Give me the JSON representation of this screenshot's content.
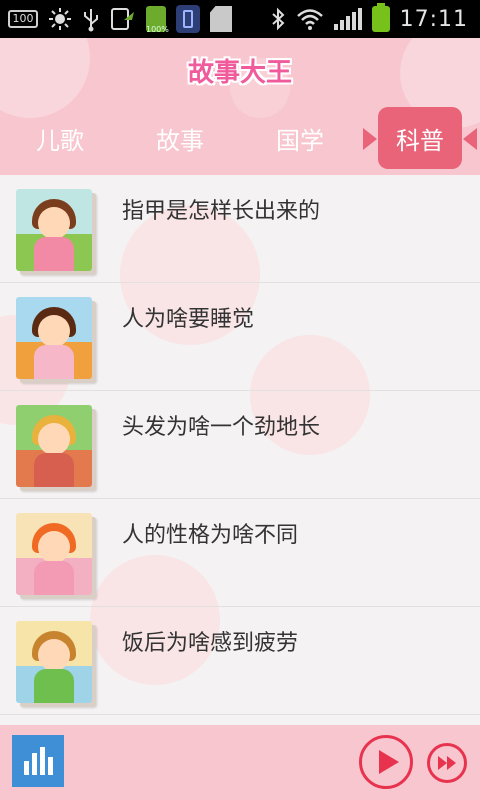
{
  "statusbar": {
    "battery_small_label": "100",
    "battery_green_label": "100%",
    "time": "17:11",
    "icons": [
      "battery-100-icon",
      "sun-icon",
      "usb-icon",
      "sync-icon",
      "battery-full-icon",
      "phone-icon",
      "sd-card-icon",
      "bluetooth-icon",
      "wifi-icon",
      "signal-icon",
      "battery-icon"
    ]
  },
  "header": {
    "title": "故事大王",
    "tabs": [
      {
        "label": "儿歌"
      },
      {
        "label": "故事"
      },
      {
        "label": "国学"
      },
      {
        "label": "科普",
        "active": true
      }
    ]
  },
  "list": {
    "items": [
      {
        "title": "指甲是怎样长出来的",
        "thumb": "girl-hands-thumbnail"
      },
      {
        "title": "人为啥要睡觉",
        "thumb": "girl-sleeping-thumbnail"
      },
      {
        "title": "头发为啥一个劲地长",
        "thumb": "girl-long-hair-thumbnail"
      },
      {
        "title": "人的性格为啥不同",
        "thumb": "boy-cooking-thumbnail"
      },
      {
        "title": "饭后为啥感到疲劳",
        "thumb": "baby-sleepy-thumbnail"
      }
    ]
  },
  "bottombar": {
    "icons": [
      "equalizer-icon",
      "play-icon",
      "fast-forward-icon"
    ]
  },
  "colors": {
    "accent": "#e96479",
    "header_bg": "#f7c6ce",
    "title_pink": "#f05b9c",
    "player_red": "#e8334f",
    "eq_blue": "#3f8fd6"
  }
}
